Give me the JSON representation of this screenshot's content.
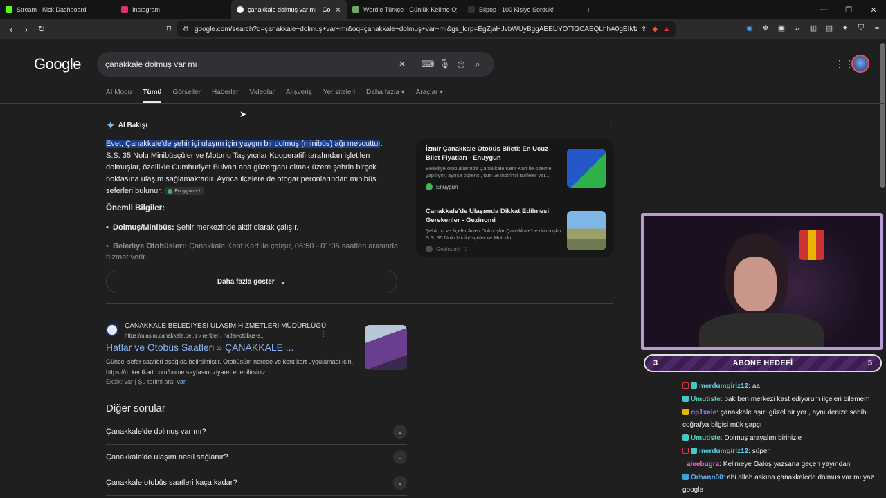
{
  "browser": {
    "tabs": [
      {
        "title": "Stream - Kick Dashboard",
        "favicon_color": "#53fc18"
      },
      {
        "title": "Instagram",
        "favicon_color": "#e1306c"
      },
      {
        "title": "çanakkale dolmuş var mı - Goog",
        "favicon_color": "#ffffff"
      },
      {
        "title": "Wordle Türkçe - Günlük Kelime Oyun",
        "favicon_color": "#6aaa64"
      },
      {
        "title": "Bilpop - 100 Kişiye Sorduk!",
        "favicon_color": "#222222"
      }
    ],
    "url": "google.com/search?q=çanakkale+dolmuş+var+mı&oq=çanakkale+dolmuş+var+mı&gs_lcrp=EgZjaHJvbWUyBggAEEUYOTIGCAEQLhhA0gEIMzYwN..."
  },
  "google": {
    "logo": "Google",
    "query": "çanakkale dolmuş var mı",
    "tabs": [
      "AI Modu",
      "Tümü",
      "Görseller",
      "Haberler",
      "Videolar",
      "Alışveriş",
      "Yer siteleri",
      "Daha fazla ▾",
      "Araçlar ▾"
    ]
  },
  "ai_overview": {
    "heading": "AI Bakışı",
    "highlight": "Evet, Çanakkale'de şehir içi ulaşım için yaygın bir dolmuş (minibüs) ağı mevcuttur",
    "body": ". S.S. 35 Nolu Minibüsçüler ve Motorlu Taşıyıcılar Kooperatifi tarafından işletilen dolmuşlar, özellikle Cumhuriyet Bulvarı ana güzergahı olmak üzere şehrin birçok noktasına ulaşım sağlamaktadır. Ayrıca ilçelere de otogar peronlarından minibüs seferleri bulunur.",
    "chip": "Enuygun +1",
    "subheading": "Önemli Bilgiler:",
    "bullet1_label": "Dolmuş/Minibüs:",
    "bullet1_text": " Şehir merkezinde aktif olarak çalışır.",
    "bullet2_label": "Belediye Otobüsleri:",
    "bullet2_text": " Çanakkale Kent Kart ile çalışır, 06:50 - 01:05 saatleri arasında hizmet verir.",
    "more_button": "Daha fazla göster"
  },
  "sources": [
    {
      "title": "İzmir Çanakkale Otobüs Bileti: En Ucuz Bilet Fiyatları - Enuygun",
      "desc": "Belediye otobüslerinde Çanakkale Kent Kart ile ödeme yapılıyor, ayrıca öğrenci, tam ve indirimli tarifeler var...",
      "site": "Enuygun"
    },
    {
      "title": "Çanakkale'de Ulaşımda Dikkat Edilmesi Gerekenler - Gezinomi",
      "desc": "Şehir İçi ve İlçeler Arası Dolmuşlar Çanakkale'de dolmuşlar S.S. 35 Nolu Minibüsçüler ve Motorlu...",
      "site": "Gezinomi"
    }
  ],
  "result": {
    "site": "ÇANAKKALE BELEDİYESİ ULAŞIM HİZMETLERİ MÜDÜRLÜĞÜ",
    "url": "https://ulasim.canakkale.bel.tr › rehber › hatlar-otobus-s...",
    "title": "Hatlar ve Otobüs Saatleri » ÇANAKKALE ...",
    "snippet": "Güncel sefer saatleri aşağıda belirtilmiştir. Otobüsüm nerede ve kent kart uygulaması için. https://m.kentkart.com/home sayfasını ziyaret edebilirsiniz.",
    "missing_label": "Eksik: var | Şu terimi ara: ",
    "missing_link": "var"
  },
  "paa": {
    "title": "Diğer sorular",
    "items": [
      "Çanakkale'de dolmuş var mı?",
      "Çanakkale'de ulaşım nasıl sağlanır?",
      "Çanakkale otobüs saatleri kaça kadar?"
    ]
  },
  "stream": {
    "goal_left": "3",
    "goal_label": "ABONE HEDEFİ",
    "goal_right": "5",
    "chat": [
      {
        "user": "merdumgiriz12",
        "text": ": aa",
        "color": "#5fd2e6",
        "badge": "b-red"
      },
      {
        "user": "Umutiste",
        "text": ": bak ben merkezi kast ediyorum ilçeleri bilemem",
        "color": "#4fd0b8",
        "badge": "b-teal"
      },
      {
        "user": "op1xele",
        "text": ": çanakkale aşırı güzel bir yer , aynı denize sahibi coğrafya bilgisi mük şapçı",
        "color": "#9b7cf0",
        "badge": "b-gold"
      },
      {
        "user": "Umutiste",
        "text": ": Dolmuş arayalım birinizle",
        "color": "#4fd0b8",
        "badge": "b-teal"
      },
      {
        "user": "merdumgiriz12",
        "text": ": süper",
        "color": "#5fd2e6",
        "badge": "b-red"
      },
      {
        "user": "aleebugra",
        "text": ": Kelimeye Galoş yazsana geçen yayından",
        "color": "#e46ad3",
        "badge": "b-none"
      },
      {
        "user": "Orhann00",
        "text": ": abi allah askına çanakkalede dolmus var mı yaz google",
        "color": "#5aa8f0",
        "badge": "b-blue"
      }
    ]
  }
}
